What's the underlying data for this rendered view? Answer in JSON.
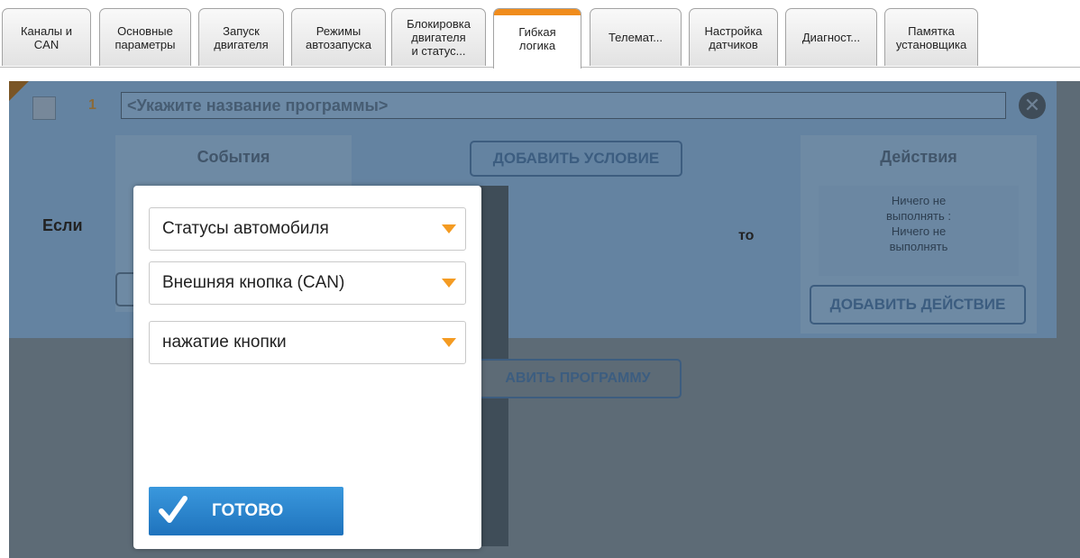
{
  "tabs": [
    {
      "label": "Каналы и\nCAN"
    },
    {
      "label": "Основные\nпараметры"
    },
    {
      "label": "Запуск\nдвигателя"
    },
    {
      "label": "Режимы\nавтозапуска"
    },
    {
      "label": "Блокировка\nдвигателя\nи статус..."
    },
    {
      "label": "Гибкая\nлогика",
      "active": true
    },
    {
      "label": "Телемат..."
    },
    {
      "label": "Настройка\nдатчиков"
    },
    {
      "label": "Диагност..."
    },
    {
      "label": "Памятка\nустановщика"
    }
  ],
  "program": {
    "number": "1",
    "name_placeholder": "<Укажите название программы>",
    "if_label": "Если",
    "then_label": "то",
    "events_title": "События",
    "add_condition": "ДОБАВИТЬ УСЛОВИЕ",
    "actions_title": "Действия",
    "actions_text": "Ничего не\nвыполнять :\nНичего не\nвыполнять",
    "add_action": "ДОБАВИТЬ ДЕЙСТВИЕ"
  },
  "add_program": "АВИТЬ ПРОГРАММУ",
  "dialog": {
    "select_category": "Статусы автомобиля",
    "select_source": "Внешняя кнопка (CAN)",
    "select_event": "нажатие кнопки",
    "done_label": "ГОТОВО"
  },
  "colors": {
    "accent_orange": "#f08c1c",
    "done_blue": "#2b86cf",
    "program_bg": "#6483a1"
  }
}
